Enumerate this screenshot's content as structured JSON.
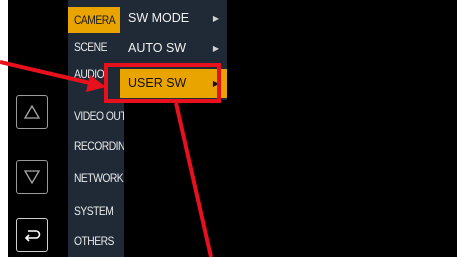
{
  "main_menu": {
    "items": [
      {
        "label": "CAMERA",
        "active": true
      },
      {
        "label": "SCENE"
      },
      {
        "label": "AUDIO"
      },
      {
        "label": "VIDEO OUT"
      },
      {
        "label": "RECORDING"
      },
      {
        "label": "NETWORK"
      },
      {
        "label": "SYSTEM"
      },
      {
        "label": "OTHERS"
      }
    ]
  },
  "sub_menu": {
    "items": [
      {
        "label": "SW MODE",
        "arrow": "▶"
      },
      {
        "label": "AUTO SW",
        "arrow": "▶"
      },
      {
        "label": "USER SW",
        "arrow": "▶",
        "active": true
      }
    ]
  },
  "controls": {
    "up_icon": "triangle-up-icon",
    "down_icon": "triangle-down-icon",
    "back_icon": "return-arrow-icon"
  },
  "colors": {
    "accent": "#e9a400",
    "menu_bg": "#1f2a36",
    "annotation": "#e8101c"
  }
}
